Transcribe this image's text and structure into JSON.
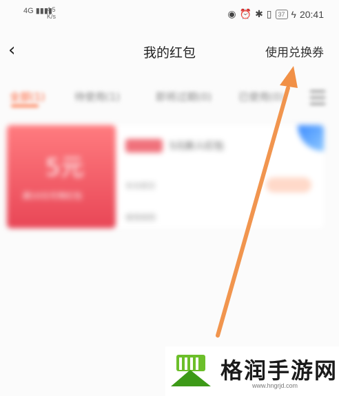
{
  "status_bar": {
    "network": "4G",
    "speed": "4.5",
    "speed_unit": "K/s",
    "battery": "37",
    "time": "20:41"
  },
  "header": {
    "back_icon": "chevron-left-icon",
    "title": "我的红包",
    "redeem_label": "使用兑换券"
  },
  "tabs": [
    {
      "label": "全部",
      "count": "(1)"
    },
    {
      "label": "待使用",
      "count": "(1)"
    },
    {
      "label": "即将过期",
      "count": "(0)"
    },
    {
      "label": "已使用",
      "count": "(0)"
    }
  ],
  "coupon": {
    "amount": "5元",
    "left_desc": "满10元可用红包",
    "tag": "新人专享",
    "name": "5元新人红包",
    "sub": "有效期至",
    "link": "使用规则"
  },
  "watermark": {
    "text": "格润手游网",
    "url": "www.hngrjd.com"
  },
  "colors": {
    "arrow": "#f08a3c",
    "coupon_red": "#e84656",
    "active_tab": "#ff5a2c"
  }
}
